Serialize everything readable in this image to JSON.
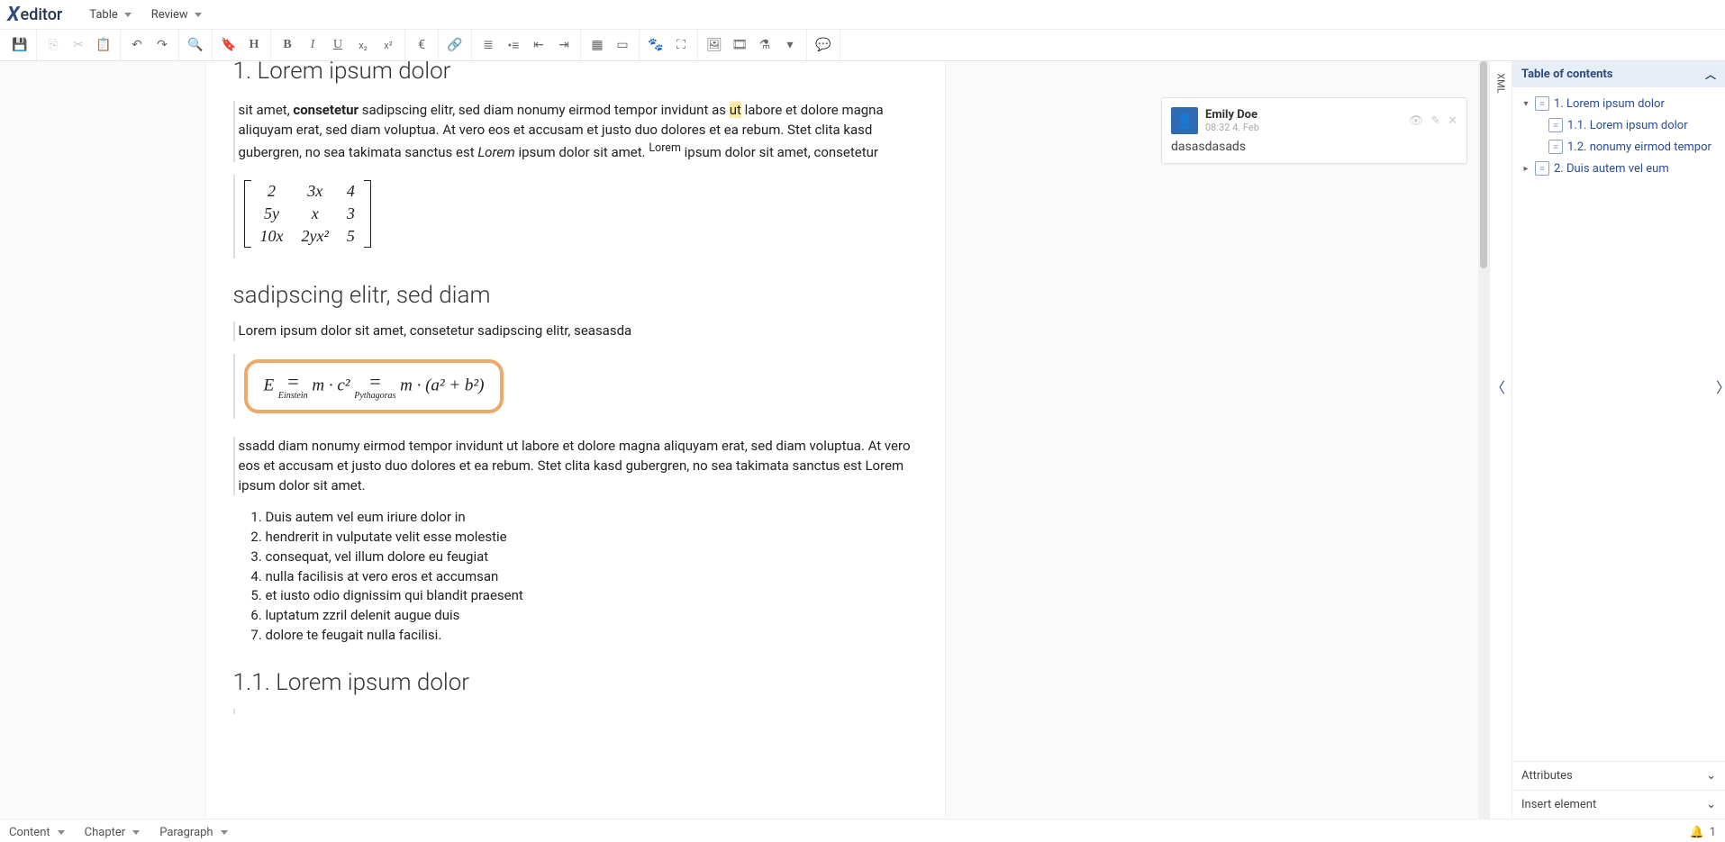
{
  "app": {
    "name": "editor",
    "logo_prefix": "X"
  },
  "menus": {
    "table": "Table",
    "review": "Review"
  },
  "toolbar": {
    "save": "💾",
    "copy": "⎘",
    "cut": "✂",
    "paste": "📋",
    "undo": "↶",
    "redo": "↷",
    "search": "🔍",
    "bookmark": "🔖",
    "heading": "H",
    "bold": "B",
    "italic": "I",
    "underline": "U",
    "sub": "x₂",
    "sup": "x²",
    "euro": "€",
    "link": "🔗",
    "ol": "≣",
    "ul": "•≡",
    "indent_out": "⇤",
    "indent_in": "⇥",
    "table": "▦",
    "object": "▭",
    "paw": "🐾",
    "fullscreen": "⛶",
    "image": "🖼",
    "video": "🎞",
    "beaker": "⚗",
    "more": "▾",
    "comment": "💬"
  },
  "doc": {
    "h1": "1. Lorem ipsum dolor",
    "p1_a": "sit amet, ",
    "p1_b_bold": "consetetur",
    "p1_c": " sadipscing elitr, sed diam nonumy eirmod tempor invidunt as ",
    "p1_hl": "ut",
    "p1_d": " labore et dolore magna aliquyam erat, sed diam voluptua. At vero eos et accusam et justo duo dolores et ea rebum. Stet clita kasd gubergren, no sea takimata sanctus est ",
    "p1_e_italic": "Lorem",
    "p1_f": " ipsum dolor sit amet. ",
    "p1_g_sup": "Lorem",
    "p1_h": " ipsum dolor sit amet, consetetur",
    "matrix": [
      [
        "2",
        "3x",
        "4"
      ],
      [
        "5y",
        "x",
        "3"
      ],
      [
        "10x",
        "2yx²",
        "5"
      ]
    ],
    "h2": "sadipscing elitr, sed diam",
    "p2": "Lorem ipsum dolor sit amet, consetetur sadipscing elitr, seasasda",
    "formula": {
      "E": "E",
      "eq": "=",
      "einstein": "Einstein",
      "mc2": "m · c²",
      "pyth": "Pythagoras",
      "rhs": "m · (a² + b²)"
    },
    "p3": "ssadd  diam nonumy eirmod tempor invidunt ut labore et dolore magna aliquyam erat, sed diam voluptua. At vero eos et accusam et justo duo dolores et ea rebum. Stet clita kasd gubergren, no sea takimata sanctus est Lorem ipsum dolor sit amet.",
    "list": [
      "Duis autem vel eum iriure dolor in",
      "hendrerit in vulputate velit esse molestie",
      "consequat, vel illum dolore eu feugiat",
      "nulla facilisis at vero eros et accumsan",
      "et iusto odio dignissim qui blandit praesent",
      "luptatum zzril delenit augue duis",
      "dolore te feugait nulla facilisi."
    ],
    "h1_1": "1.1. Lorem ipsum dolor"
  },
  "comment": {
    "user": "Emily Doe",
    "time": "08:32 4. Feb",
    "body": "dasasdasads",
    "view": "👁",
    "edit": "✎",
    "close": "✕"
  },
  "xml_tab": "XML",
  "side": {
    "toc_label": "Table of contents",
    "items": [
      {
        "level": 1,
        "caret": "▾",
        "label": "1. Lorem ipsum dolor"
      },
      {
        "level": 2,
        "caret": "",
        "label": "1.1. Lorem ipsum dolor"
      },
      {
        "level": 2,
        "caret": "",
        "label": "1.2. nonumy eirmod tempor"
      },
      {
        "level": 1,
        "caret": "▸",
        "label": "2. Duis autem vel eum"
      }
    ],
    "attributes": "Attributes",
    "insert": "Insert element",
    "collapse_up": "〳",
    "chev_down": "⌄"
  },
  "status": {
    "content": "Content",
    "chapter": "Chapter",
    "paragraph": "Paragraph",
    "bell": "🔔",
    "count": "1"
  }
}
